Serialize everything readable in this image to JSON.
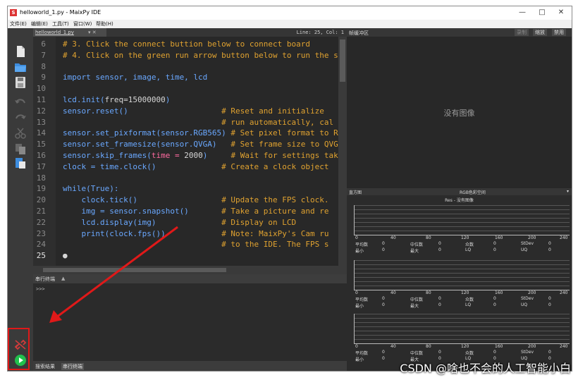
{
  "window": {
    "title": "helloworld_1.py - MaixPy IDE",
    "app_icon": "S",
    "controls": [
      "—",
      "□",
      "✕"
    ]
  },
  "menu": [
    "文件(E)",
    "编辑(E)",
    "工具(T)",
    "窗口(W)",
    "帮助(H)"
  ],
  "editor": {
    "tab_name": "helloworld_1.py",
    "tab_close": "▾ ✕",
    "line_col": "Line: 25, Col: 1",
    "line_numbers": [
      "6",
      "7",
      "8",
      "9",
      "10",
      "11",
      "12",
      "13",
      "14",
      "15",
      "16",
      "17",
      "18",
      "19",
      "20",
      "21",
      "22",
      "23",
      "24",
      "25"
    ],
    "lines": [
      [
        {
          "t": "# 3. Click the connect buttion below to connect board",
          "c": "comment"
        }
      ],
      [
        {
          "t": "# 4. Click on the green run arrow button below to run the s",
          "c": "comment"
        }
      ],
      [
        {
          "t": "",
          "c": "plain"
        }
      ],
      [
        {
          "t": "import sensor, image, time, lcd",
          "c": "kw"
        }
      ],
      [
        {
          "t": "",
          "c": "plain"
        }
      ],
      [
        {
          "t": "lcd.init(",
          "c": "kw"
        },
        {
          "t": "freq=15000000",
          "c": "plain"
        },
        {
          "t": ")",
          "c": "kw"
        }
      ],
      [
        {
          "t": "sensor.reset()",
          "c": "kw"
        },
        {
          "t": "                    ",
          "c": "plain"
        },
        {
          "t": "# Reset and initialize ",
          "c": "comment"
        }
      ],
      [
        {
          "t": "                                  ",
          "c": "plain"
        },
        {
          "t": "# run automatically, cal",
          "c": "comment"
        }
      ],
      [
        {
          "t": "sensor.set_pixformat(sensor.RGB565)",
          "c": "kw"
        },
        {
          "t": " ",
          "c": "plain"
        },
        {
          "t": "# Set pixel format to R",
          "c": "comment"
        }
      ],
      [
        {
          "t": "sensor.set_framesize(sensor.QVGA)",
          "c": "kw"
        },
        {
          "t": "   ",
          "c": "plain"
        },
        {
          "t": "# Set frame size to QVG",
          "c": "comment"
        }
      ],
      [
        {
          "t": "sensor.skip_frames(",
          "c": "kw"
        },
        {
          "t": "time = ",
          "c": "pink"
        },
        {
          "t": "2000",
          "c": "plain"
        },
        {
          "t": ")",
          "c": "kw"
        },
        {
          "t": "     ",
          "c": "plain"
        },
        {
          "t": "# Wait for settings tak",
          "c": "comment"
        }
      ],
      [
        {
          "t": "clock = time.clock()",
          "c": "kw"
        },
        {
          "t": "              ",
          "c": "plain"
        },
        {
          "t": "# Create a clock object",
          "c": "comment"
        }
      ],
      [
        {
          "t": "",
          "c": "plain"
        }
      ],
      [
        {
          "t": "while(True):",
          "c": "kw"
        }
      ],
      [
        {
          "t": "    clock.tick()",
          "c": "kw"
        },
        {
          "t": "                  ",
          "c": "plain"
        },
        {
          "t": "# Update the FPS clock.",
          "c": "comment"
        }
      ],
      [
        {
          "t": "    img = sensor.snapshot()",
          "c": "kw"
        },
        {
          "t": "       ",
          "c": "plain"
        },
        {
          "t": "# Take a picture and re",
          "c": "comment"
        }
      ],
      [
        {
          "t": "    lcd.display(img)",
          "c": "kw"
        },
        {
          "t": "              ",
          "c": "plain"
        },
        {
          "t": "# Display on LCD",
          "c": "comment"
        }
      ],
      [
        {
          "t": "    print(clock.fps())",
          "c": "kw"
        },
        {
          "t": "            ",
          "c": "plain"
        },
        {
          "t": "# Note: MaixPy's Cam ru",
          "c": "comment"
        }
      ],
      [
        {
          "t": "                                  ",
          "c": "plain"
        },
        {
          "t": "# to the IDE. The FPS s",
          "c": "comment"
        }
      ],
      [
        {
          "t": "●",
          "c": "dot"
        }
      ]
    ]
  },
  "terminal": {
    "tab_label": "串行终端",
    "prompt": ">>>"
  },
  "statusbar": {
    "left": "搜索结果",
    "right": "串行终端"
  },
  "framebuffer": {
    "title": "帧缓冲区",
    "buttons": [
      "录制",
      "缩放",
      "禁用"
    ],
    "no_image": "没有图像"
  },
  "histogram": {
    "title": "直方图",
    "colorspace": "RGB色彩空间",
    "subtitle": "Res - 没有图像",
    "x_ticks": [
      "0",
      "40",
      "80",
      "120",
      "160",
      "200",
      "240"
    ],
    "stats_row1": [
      "平均数",
      "0",
      "中位数",
      "0",
      "众数",
      "0",
      "StDev",
      "0"
    ],
    "stats_row2": [
      "最小",
      "0",
      "最大",
      "0",
      "LQ",
      "0",
      "UQ",
      "0"
    ]
  },
  "watermark": "CSDN @啥也不会的人工智能小白",
  "colors": {
    "comment": "#e0a230",
    "keyword": "#6aa8ff",
    "pink": "#ff6aa0",
    "plain": "#d6d6d6",
    "annotation": "#e01919",
    "run_green": "#21c04c"
  }
}
